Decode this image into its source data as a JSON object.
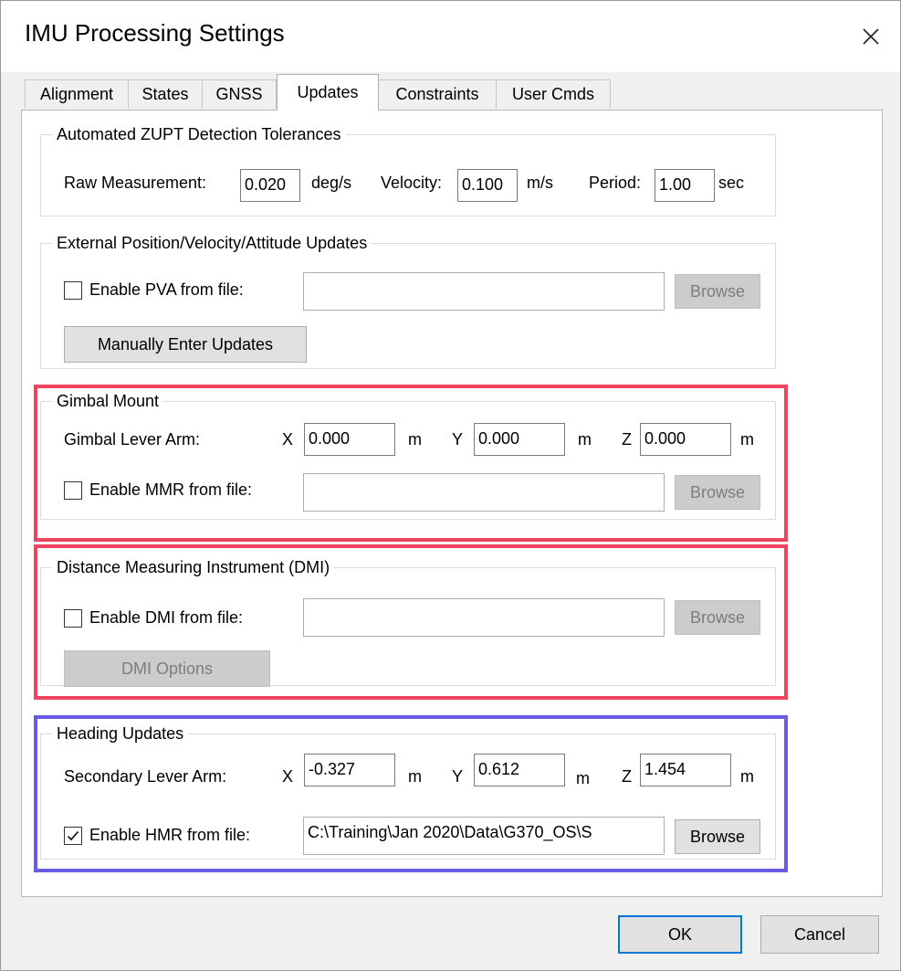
{
  "window": {
    "title": "IMU Processing Settings"
  },
  "tabs": [
    {
      "label": "Alignment"
    },
    {
      "label": "States"
    },
    {
      "label": "GNSS"
    },
    {
      "label": "Updates"
    },
    {
      "label": "Constraints"
    },
    {
      "label": "User Cmds"
    }
  ],
  "zupt": {
    "title": "Automated ZUPT Detection Tolerances",
    "raw_label": "Raw Measurement:",
    "raw_value": "0.020",
    "raw_unit": "deg/s",
    "vel_label": "Velocity:",
    "vel_value": "0.100",
    "vel_unit": "m/s",
    "period_label": "Period:",
    "period_value": "1.00",
    "period_unit": "sec"
  },
  "pva": {
    "title": "External Position/Velocity/Attitude Updates",
    "enable_label": "Enable PVA from file:",
    "enabled": false,
    "file_value": "",
    "browse_label": "Browse",
    "manual_label": "Manually Enter Updates"
  },
  "gimbal": {
    "title": "Gimbal Mount",
    "lever_label": "Gimbal Lever Arm:",
    "x_label": "X",
    "x_value": "0.000",
    "x_unit": "m",
    "y_label": "Y",
    "y_value": "0.000",
    "y_unit": "m",
    "z_label": "Z",
    "z_value": "0.000",
    "z_unit": "m",
    "enable_label": "Enable MMR from file:",
    "enabled": false,
    "file_value": "",
    "browse_label": "Browse"
  },
  "dmi": {
    "title": "Distance Measuring Instrument (DMI)",
    "enable_label": "Enable DMI from file:",
    "enabled": false,
    "file_value": "",
    "browse_label": "Browse",
    "options_label": "DMI Options"
  },
  "heading": {
    "title": "Heading Updates",
    "lever_label": "Secondary Lever Arm:",
    "x_label": "X",
    "x_value": "-0.327",
    "x_unit": "m",
    "y_label": "Y",
    "y_value": "0.612",
    "y_unit": "m",
    "z_label": "Z",
    "z_value": "1.454",
    "z_unit": "m",
    "enable_label": "Enable HMR from file:",
    "enabled": true,
    "file_value": "C:\\Training\\Jan 2020\\Data\\G370_OS\\S",
    "browse_label": "Browse"
  },
  "footer": {
    "ok_label": "OK",
    "cancel_label": "Cancel"
  },
  "icons": {
    "close": "close-icon",
    "checkmark": "checkmark-icon"
  },
  "colors": {
    "highlight_red": "#f0435e",
    "highlight_blue": "#6a5ae8",
    "default_button_border": "#0078d7"
  }
}
